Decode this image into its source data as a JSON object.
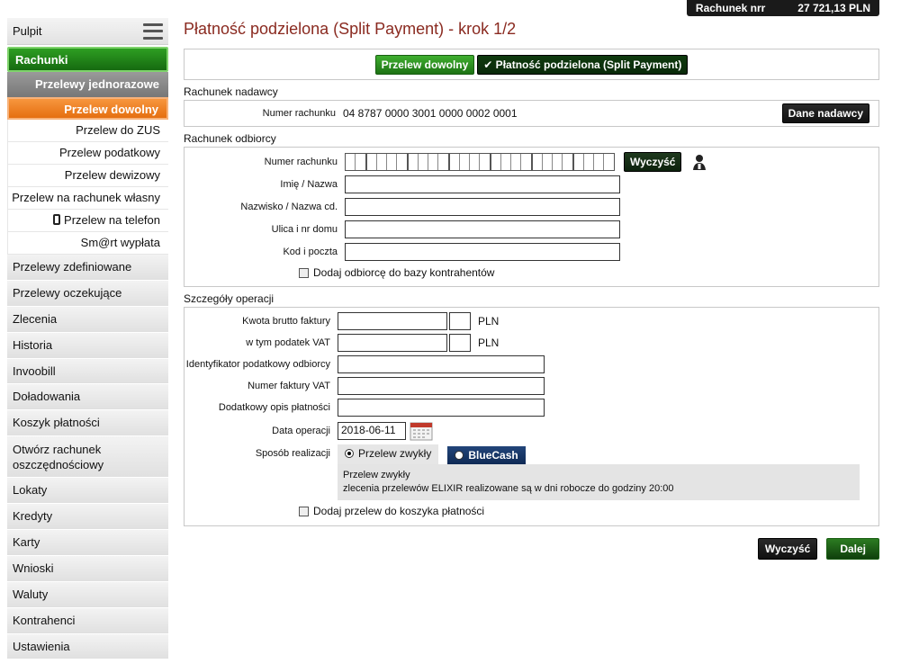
{
  "topbar": {
    "account_label": "Rachunek nrr",
    "balance": "27 721,13 PLN"
  },
  "sidebar": {
    "pulpit": "Pulpit",
    "rachunki": "Rachunki",
    "jednorazowe": "Przelewy jednorazowe",
    "sub": [
      "Przelew dowolny",
      "Przelew do ZUS",
      "Przelew podatkowy",
      "Przelew dewizowy",
      "Przelew na rachunek własny",
      "Przelew na telefon",
      "Sm@rt wypłata"
    ],
    "main": [
      "Przelewy zdefiniowane",
      "Przelewy oczekujące",
      "Zlecenia",
      "Historia",
      "Invoobill",
      "Doładowania",
      "Koszyk płatności",
      "Otwórz rachunek oszczędnościowy",
      "Lokaty",
      "Kredyty",
      "Karty",
      "Wnioski",
      "Waluty",
      "Kontrahenci",
      "Ustawienia"
    ]
  },
  "page": {
    "title": "Płatność podzielona (Split Payment) - krok 1/2"
  },
  "tabs": {
    "dowolny": "Przelew dowolny",
    "split": "✔ Płatność podzielona (Split Payment)"
  },
  "nadawca": {
    "section": "Rachunek nadawcy",
    "label": "Numer rachunku",
    "value": "04 8787 0000 3001 0000 0002 0001",
    "button": "Dane nadawcy"
  },
  "odbiorca": {
    "section": "Rachunek odbiorcy",
    "account_label": "Numer rachunku",
    "clear_button": "Wyczyść",
    "fields": [
      "Imię / Nazwa",
      "Nazwisko / Nazwa cd.",
      "Ulica i nr domu",
      "Kod i poczta"
    ],
    "add_contractor": "Dodaj odbiorcę do bazy kontrahentów"
  },
  "szczegoly": {
    "section": "Szczegóły operacji",
    "kwota_label": "Kwota brutto faktury",
    "vat_label": "w tym podatek VAT",
    "currency": "PLN",
    "nip_label": "Identyfikator podatkowy odbiorcy",
    "faktura_label": "Numer faktury VAT",
    "opis_label": "Dodatkowy opis płatności",
    "data_label": "Data operacji",
    "data_value": "2018-06-11",
    "sposob_label": "Sposób realizacji",
    "opt_zwykly": "Przelew zwykły",
    "opt_bluecash": "BlueCash",
    "info_title": "Przelew zwykły",
    "info_text": "zlecenia przelewów ELIXIR realizowane są w dni robocze do godziny 20:00",
    "add_basket": "Dodaj przelew do koszyka płatności"
  },
  "actions": {
    "clear": "Wyczyść",
    "next": "Dalej"
  }
}
